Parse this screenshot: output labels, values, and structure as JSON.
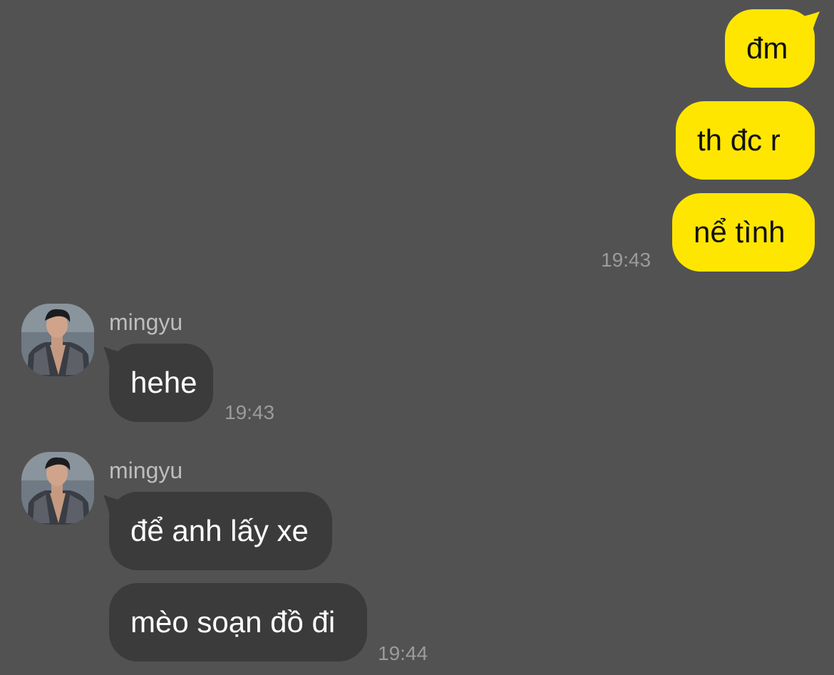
{
  "colors": {
    "background": "#535253",
    "outgoing_bubble": "#FFE600",
    "incoming_bubble": "#3B3B3C",
    "timestamp": "#9C9B9C"
  },
  "outgoing": {
    "messages": [
      "đm",
      "th đc r",
      "nể tình"
    ],
    "time": "19:43"
  },
  "incoming_groups": [
    {
      "sender": "mingyu",
      "avatar_icon": "profile-photo",
      "messages": [
        "hehe"
      ],
      "time": "19:43"
    },
    {
      "sender": "mingyu",
      "avatar_icon": "profile-photo",
      "messages": [
        "để anh lấy xe",
        "mèo soạn đồ đi"
      ],
      "time": "19:44"
    }
  ]
}
